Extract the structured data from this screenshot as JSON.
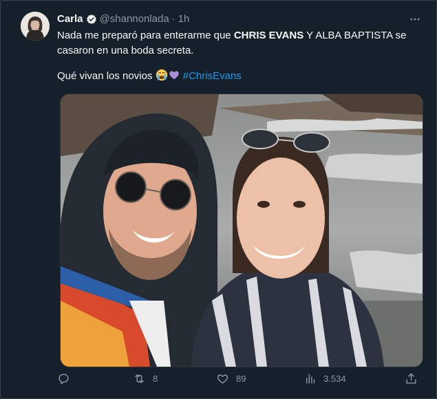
{
  "author": {
    "name": "Carla",
    "handle": "@shannonlada",
    "separator": "·",
    "time": "1h"
  },
  "tweet": {
    "line1_pre": "Nada me preparó para enterarme que ",
    "line1_bold": "CHRIS EVANS",
    "line1_post": " Y ALBA BAPTISTA se casaron en una boda secreta.",
    "line2_text": "Qué vivan los novios ",
    "hashtag": "#ChrisEvans"
  },
  "actions": {
    "reply_count": "",
    "retweet_count": "8",
    "like_count": "89",
    "views_count": "3.534"
  },
  "icons": [
    "verified-icon",
    "more-icon",
    "reply-icon",
    "retweet-icon",
    "like-icon",
    "views-icon",
    "share-icon"
  ],
  "colors": {
    "background": "#15202b",
    "text": "#f7f9f9",
    "muted": "#8b98a5",
    "link": "#1d9bf0"
  }
}
